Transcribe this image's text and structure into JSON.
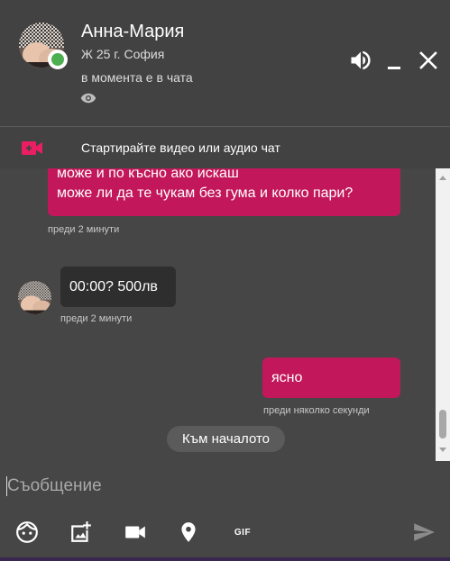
{
  "header": {
    "name": "Анна-Мария",
    "meta": "Ж 25 г. София",
    "status": "в момента е в чата"
  },
  "video_bar": {
    "label": "Стартирайте видео или аудио чат",
    "accent": "#e91e63"
  },
  "messages": [
    {
      "from": "me",
      "lines": [
        "може и по късно ако искаш",
        "може ли да те чукам без гума и колко пари?"
      ],
      "time": "преди 2 минути"
    },
    {
      "from": "them",
      "lines": [
        "00:00? 500лв"
      ],
      "time": "преди 2 минути"
    },
    {
      "from": "me",
      "lines": [
        "ясно"
      ],
      "time": "преди няколко секунди"
    }
  ],
  "to_top_label": "Към началото",
  "composer": {
    "placeholder": "Съобщение",
    "value": "",
    "gif_label": "GIF"
  },
  "colors": {
    "my_bubble": "#c2185b",
    "their_bubble": "#2e2e2e",
    "online": "#4caf50"
  }
}
